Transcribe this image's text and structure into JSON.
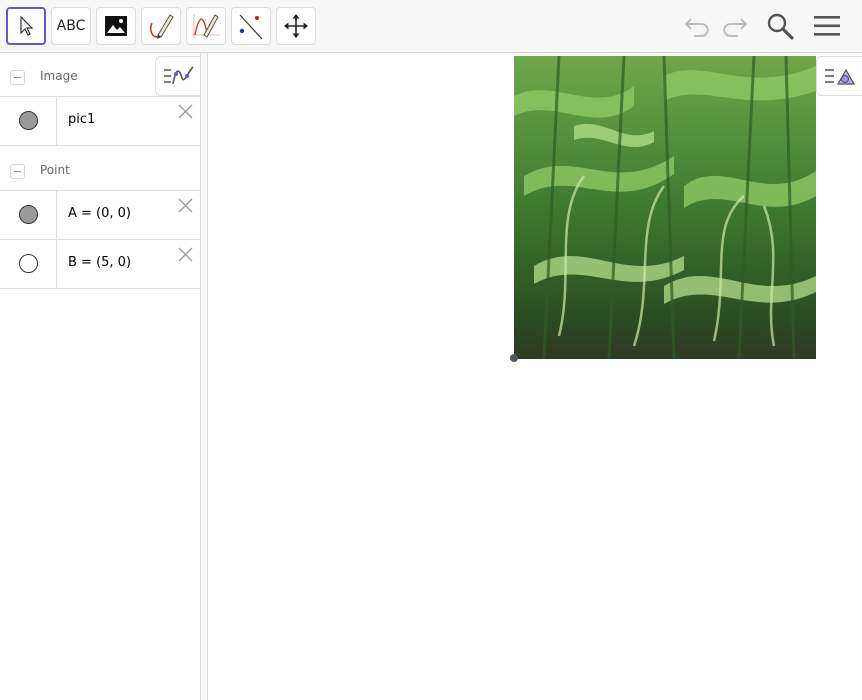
{
  "toolbar": {
    "tools": [
      {
        "name": "move-tool",
        "label": "",
        "active": true
      },
      {
        "name": "text-tool",
        "label": "ABC"
      },
      {
        "name": "image-tool",
        "label": ""
      },
      {
        "name": "pen-tool",
        "label": ""
      },
      {
        "name": "freehand-function-tool",
        "label": ""
      },
      {
        "name": "point-on-line-tool",
        "label": ""
      },
      {
        "name": "move-graphics-view-tool",
        "label": ""
      }
    ],
    "right_icons": [
      "undo-icon",
      "redo-icon",
      "search-icon",
      "menu-icon"
    ]
  },
  "algebra": {
    "groups": [
      {
        "label": "Image",
        "items": [
          {
            "definition": "pic1",
            "marble": "filled"
          }
        ]
      },
      {
        "label": "Point",
        "items": [
          {
            "definition": "A = (0, 0)",
            "marble": "filled"
          },
          {
            "definition": "B = (5, 0)",
            "marble": "empty"
          }
        ]
      }
    ]
  },
  "graphics": {
    "image_object": "pic1",
    "image_depicts": "cornfield",
    "visible_point": "A"
  }
}
